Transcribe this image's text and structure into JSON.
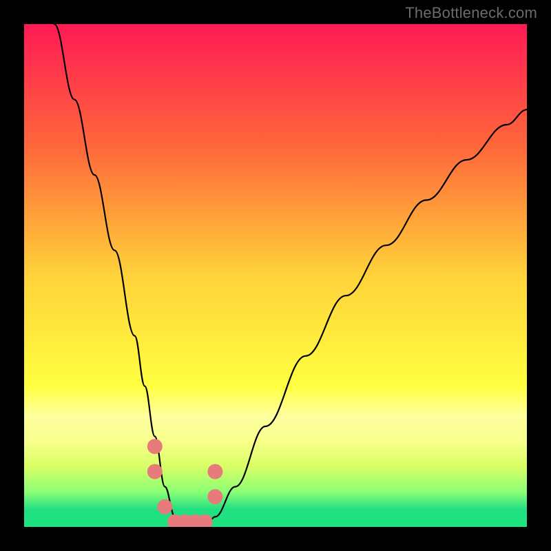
{
  "watermark": "TheBottleneck.com",
  "chart_data": {
    "type": "line",
    "title": "",
    "xlabel": "",
    "ylabel": "",
    "xlim": [
      0,
      100
    ],
    "ylim": [
      0,
      100
    ],
    "grid": false,
    "legend": false,
    "series": [
      {
        "name": "bottleneck-curve",
        "x": [
          6,
          10,
          14,
          18,
          22,
          24,
          26,
          28,
          30,
          32,
          34,
          36,
          38,
          42,
          48,
          56,
          64,
          72,
          80,
          88,
          96,
          100
        ],
        "values": [
          100,
          85,
          70,
          55,
          38,
          28,
          18,
          8,
          2,
          0,
          0,
          0,
          2,
          8,
          20,
          34,
          46,
          56,
          65,
          73,
          80,
          83
        ]
      }
    ],
    "markers": {
      "name": "highlight-dots",
      "x": [
        26,
        26,
        28,
        30,
        32,
        34,
        36,
        38,
        38
      ],
      "values": [
        16,
        11,
        4,
        1,
        1,
        1,
        1,
        6,
        11
      ]
    },
    "background_gradient": {
      "stops": [
        {
          "pos": 0.0,
          "color": "#ff1a55"
        },
        {
          "pos": 0.25,
          "color": "#ff6a3a"
        },
        {
          "pos": 0.5,
          "color": "#ffd23a"
        },
        {
          "pos": 0.72,
          "color": "#ffff40"
        },
        {
          "pos": 0.78,
          "color": "#ffffa0"
        },
        {
          "pos": 0.83,
          "color": "#f7ff8a"
        },
        {
          "pos": 0.88,
          "color": "#d8ff66"
        },
        {
          "pos": 0.93,
          "color": "#8cff74"
        },
        {
          "pos": 0.965,
          "color": "#22e082"
        },
        {
          "pos": 1.0,
          "color": "#1ae57e"
        }
      ]
    }
  }
}
